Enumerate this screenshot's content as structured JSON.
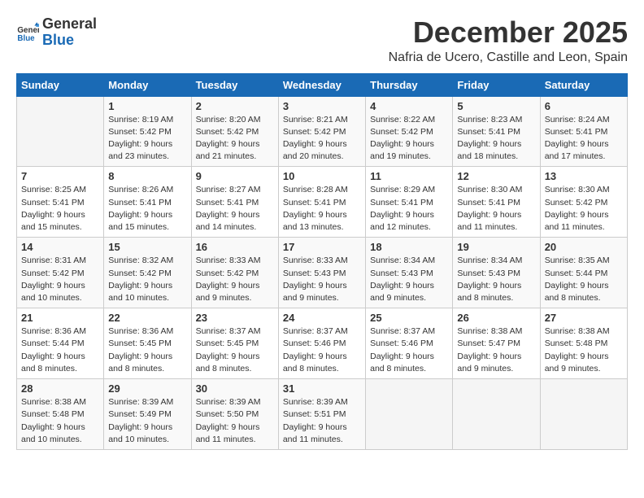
{
  "logo": {
    "general": "General",
    "blue": "Blue"
  },
  "title": "December 2025",
  "location": "Nafria de Ucero, Castille and Leon, Spain",
  "days_of_week": [
    "Sunday",
    "Monday",
    "Tuesday",
    "Wednesday",
    "Thursday",
    "Friday",
    "Saturday"
  ],
  "weeks": [
    [
      {
        "day": "",
        "info": ""
      },
      {
        "day": "1",
        "info": "Sunrise: 8:19 AM\nSunset: 5:42 PM\nDaylight: 9 hours\nand 23 minutes."
      },
      {
        "day": "2",
        "info": "Sunrise: 8:20 AM\nSunset: 5:42 PM\nDaylight: 9 hours\nand 21 minutes."
      },
      {
        "day": "3",
        "info": "Sunrise: 8:21 AM\nSunset: 5:42 PM\nDaylight: 9 hours\nand 20 minutes."
      },
      {
        "day": "4",
        "info": "Sunrise: 8:22 AM\nSunset: 5:42 PM\nDaylight: 9 hours\nand 19 minutes."
      },
      {
        "day": "5",
        "info": "Sunrise: 8:23 AM\nSunset: 5:41 PM\nDaylight: 9 hours\nand 18 minutes."
      },
      {
        "day": "6",
        "info": "Sunrise: 8:24 AM\nSunset: 5:41 PM\nDaylight: 9 hours\nand 17 minutes."
      }
    ],
    [
      {
        "day": "7",
        "info": "Sunrise: 8:25 AM\nSunset: 5:41 PM\nDaylight: 9 hours\nand 15 minutes."
      },
      {
        "day": "8",
        "info": "Sunrise: 8:26 AM\nSunset: 5:41 PM\nDaylight: 9 hours\nand 15 minutes."
      },
      {
        "day": "9",
        "info": "Sunrise: 8:27 AM\nSunset: 5:41 PM\nDaylight: 9 hours\nand 14 minutes."
      },
      {
        "day": "10",
        "info": "Sunrise: 8:28 AM\nSunset: 5:41 PM\nDaylight: 9 hours\nand 13 minutes."
      },
      {
        "day": "11",
        "info": "Sunrise: 8:29 AM\nSunset: 5:41 PM\nDaylight: 9 hours\nand 12 minutes."
      },
      {
        "day": "12",
        "info": "Sunrise: 8:30 AM\nSunset: 5:41 PM\nDaylight: 9 hours\nand 11 minutes."
      },
      {
        "day": "13",
        "info": "Sunrise: 8:30 AM\nSunset: 5:42 PM\nDaylight: 9 hours\nand 11 minutes."
      }
    ],
    [
      {
        "day": "14",
        "info": "Sunrise: 8:31 AM\nSunset: 5:42 PM\nDaylight: 9 hours\nand 10 minutes."
      },
      {
        "day": "15",
        "info": "Sunrise: 8:32 AM\nSunset: 5:42 PM\nDaylight: 9 hours\nand 10 minutes."
      },
      {
        "day": "16",
        "info": "Sunrise: 8:33 AM\nSunset: 5:42 PM\nDaylight: 9 hours\nand 9 minutes."
      },
      {
        "day": "17",
        "info": "Sunrise: 8:33 AM\nSunset: 5:43 PM\nDaylight: 9 hours\nand 9 minutes."
      },
      {
        "day": "18",
        "info": "Sunrise: 8:34 AM\nSunset: 5:43 PM\nDaylight: 9 hours\nand 9 minutes."
      },
      {
        "day": "19",
        "info": "Sunrise: 8:34 AM\nSunset: 5:43 PM\nDaylight: 9 hours\nand 8 minutes."
      },
      {
        "day": "20",
        "info": "Sunrise: 8:35 AM\nSunset: 5:44 PM\nDaylight: 9 hours\nand 8 minutes."
      }
    ],
    [
      {
        "day": "21",
        "info": "Sunrise: 8:36 AM\nSunset: 5:44 PM\nDaylight: 9 hours\nand 8 minutes."
      },
      {
        "day": "22",
        "info": "Sunrise: 8:36 AM\nSunset: 5:45 PM\nDaylight: 9 hours\nand 8 minutes."
      },
      {
        "day": "23",
        "info": "Sunrise: 8:37 AM\nSunset: 5:45 PM\nDaylight: 9 hours\nand 8 minutes."
      },
      {
        "day": "24",
        "info": "Sunrise: 8:37 AM\nSunset: 5:46 PM\nDaylight: 9 hours\nand 8 minutes."
      },
      {
        "day": "25",
        "info": "Sunrise: 8:37 AM\nSunset: 5:46 PM\nDaylight: 9 hours\nand 8 minutes."
      },
      {
        "day": "26",
        "info": "Sunrise: 8:38 AM\nSunset: 5:47 PM\nDaylight: 9 hours\nand 9 minutes."
      },
      {
        "day": "27",
        "info": "Sunrise: 8:38 AM\nSunset: 5:48 PM\nDaylight: 9 hours\nand 9 minutes."
      }
    ],
    [
      {
        "day": "28",
        "info": "Sunrise: 8:38 AM\nSunset: 5:48 PM\nDaylight: 9 hours\nand 10 minutes."
      },
      {
        "day": "29",
        "info": "Sunrise: 8:39 AM\nSunset: 5:49 PM\nDaylight: 9 hours\nand 10 minutes."
      },
      {
        "day": "30",
        "info": "Sunrise: 8:39 AM\nSunset: 5:50 PM\nDaylight: 9 hours\nand 11 minutes."
      },
      {
        "day": "31",
        "info": "Sunrise: 8:39 AM\nSunset: 5:51 PM\nDaylight: 9 hours\nand 11 minutes."
      },
      {
        "day": "",
        "info": ""
      },
      {
        "day": "",
        "info": ""
      },
      {
        "day": "",
        "info": ""
      }
    ]
  ]
}
